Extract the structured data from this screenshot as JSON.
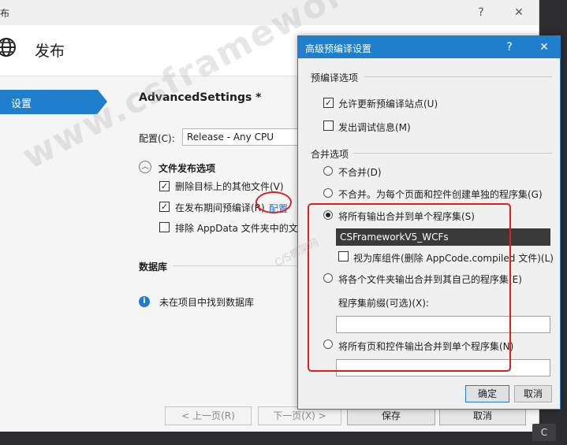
{
  "background_window": {
    "title": "布",
    "help_glyph": "?",
    "close_glyph": "✕",
    "header_title": "发布",
    "nav": [
      {
        "label": "设置"
      }
    ],
    "settings_title": "AdvancedSettings *",
    "config_label": "配置(C):",
    "config_value": "Release - Any CPU",
    "file_section_title": "文件发布选项",
    "collapse_glyph": "︿",
    "checkboxes": [
      {
        "label": "删除目标上的其他文件(V)",
        "checked": true
      },
      {
        "label": "在发布期间预编译(R)",
        "checked": true
      },
      {
        "label": "排除 AppData 文件夹中的文",
        "checked": false
      }
    ],
    "configure_link": "配置",
    "database_label": "数据库",
    "database_message": "未在项目中找到数据库",
    "buttons": {
      "prev": "< 上一页(R)",
      "next": "下一页(X) >",
      "publish": "保存",
      "cancel": "取消"
    },
    "corner_text": "C"
  },
  "dialog": {
    "title": "高级预编译设置",
    "help_glyph": "?",
    "close_glyph": "✕",
    "precompile_group": "预编译选项",
    "precompile_options": [
      {
        "label": "允许更新预编译站点(U)",
        "checked": true
      },
      {
        "label": "发出调试信息(M)",
        "checked": false
      }
    ],
    "merge_group": "合并选项",
    "merge_options": [
      {
        "label": "不合并(D)",
        "selected": false
      },
      {
        "label": "不合并。为每个页面和控件创建单独的程序集(G)",
        "selected": false
      },
      {
        "label": "将所有输出合并到单个程序集(S)",
        "selected": true
      },
      {
        "label": "将各个文件夹输出合并到其自己的程序集(E)",
        "selected": false
      },
      {
        "label": "将所有页和控件输出合并到单个程序集(N)",
        "selected": false
      }
    ],
    "assembly_name": "CSFrameworkV5_WCFs",
    "library_component": {
      "label": "视为库组件(删除 AppCode.compiled 文件)(L)",
      "checked": false
    },
    "prefix_label": "程序集前缀(可选)(X):",
    "prefix_value": "",
    "pages_assembly_value": "",
    "ok_label": "确定",
    "cancel_label": "取消"
  },
  "watermark": "www.csframework.com",
  "watermark_small": "C/S框架网",
  "colors": {
    "accent": "#1f7fcd",
    "highlight": "#e21d1d",
    "dark_field": "#3a3a3a"
  },
  "icons": {
    "globe": "globe-icon",
    "info": "info-icon"
  }
}
